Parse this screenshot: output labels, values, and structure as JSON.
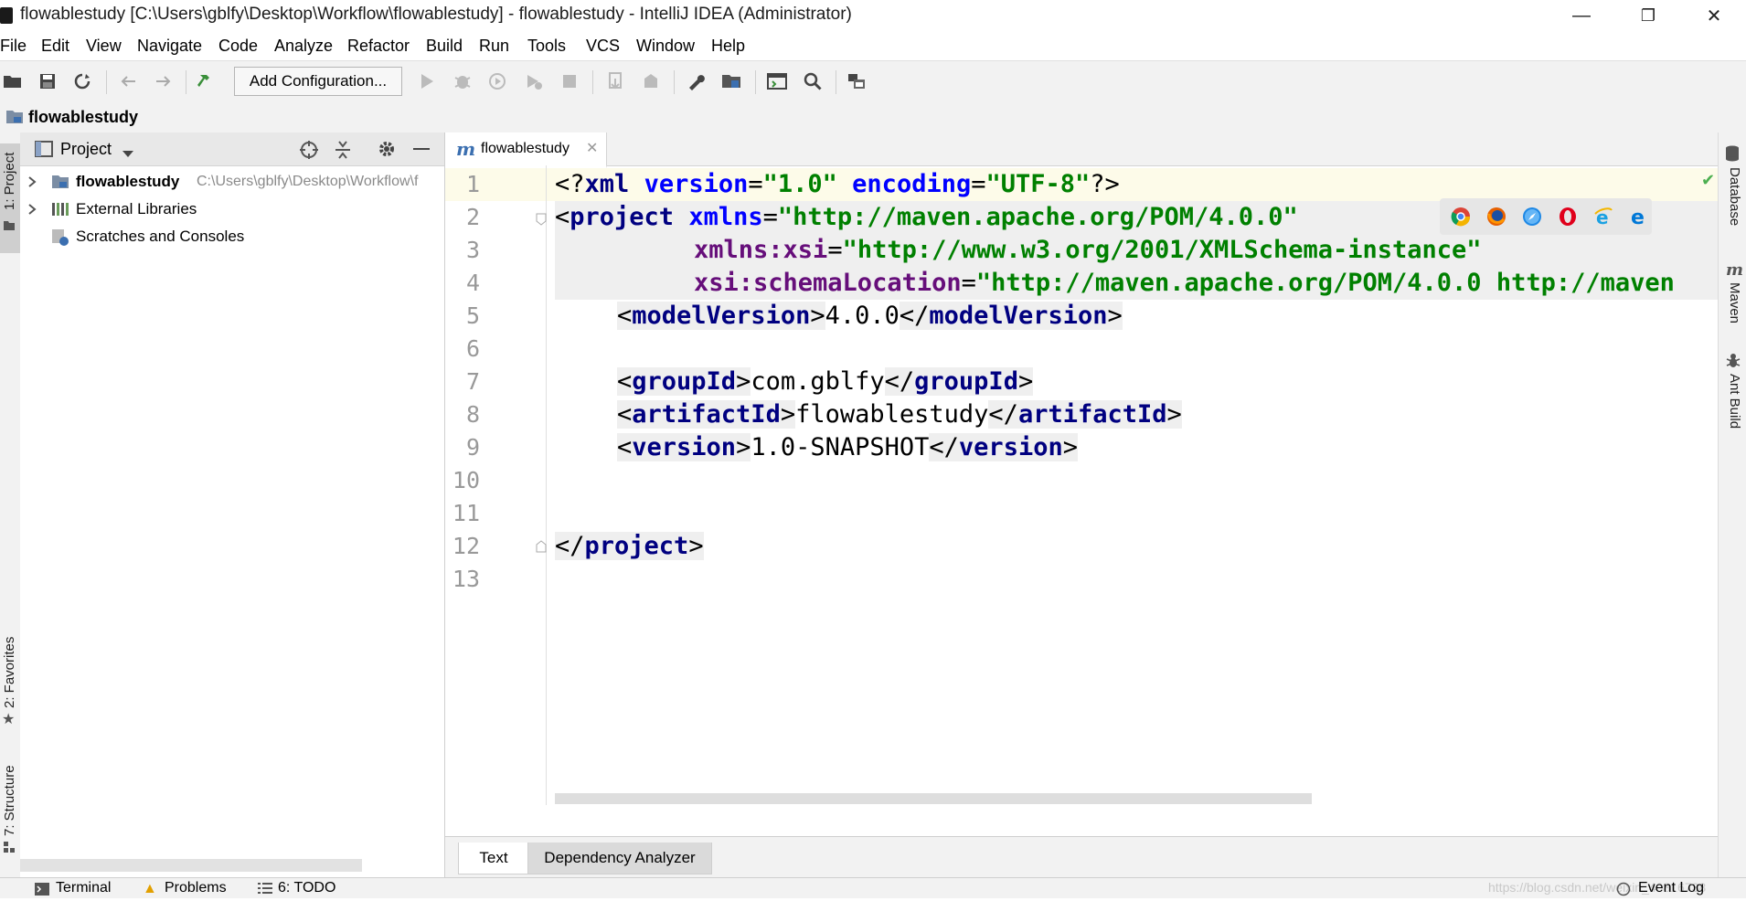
{
  "window": {
    "title": "flowablestudy [C:\\Users\\gblfy\\Desktop\\Workflow\\flowablestudy] - flowablestudy - IntelliJ IDEA (Administrator)",
    "minimize": "—",
    "restore": "❐",
    "close": "✕"
  },
  "menu": [
    "File",
    "Edit",
    "View",
    "Navigate",
    "Code",
    "Analyze",
    "Refactor",
    "Build",
    "Run",
    "Tools",
    "VCS",
    "Window",
    "Help"
  ],
  "toolbar": {
    "add_configuration": "Add Configuration..."
  },
  "breadcrumb": {
    "project": "flowablestudy"
  },
  "left_stripe": {
    "project_tab": "1: Project",
    "favorites_tab": "2: Favorites",
    "structure_tab": "7: Structure"
  },
  "project_panel": {
    "title": "Project",
    "tree": [
      {
        "label": "flowablestudy",
        "path": "C:\\Users\\gblfy\\Desktop\\Workflow\\f",
        "icon": "folder-icon"
      },
      {
        "label": "External Libraries",
        "icon": "libraries-icon"
      },
      {
        "label": "Scratches and Consoles",
        "icon": "scratches-icon"
      }
    ]
  },
  "editor": {
    "tab_label": "flowablestudy",
    "line_numbers": [
      "1",
      "2",
      "3",
      "4",
      "5",
      "6",
      "7",
      "8",
      "9",
      "10",
      "11",
      "12",
      "13"
    ],
    "code": {
      "l1_decl": "<?",
      "l1_xml": "xml",
      "l1_version_attr": "version",
      "l1_version_val": "\"1.0\"",
      "l1_encoding_attr": "encoding",
      "l1_encoding_val": "\"UTF-8\"",
      "l1_end": "?>",
      "l2_tag": "project",
      "l2_attr": "xmlns",
      "l2_val": "\"http://maven.apache.org/POM/4.0.0\"",
      "l3_ns": "xmlns:xsi",
      "l3_val": "\"http://www.w3.org/2001/XMLSchema-instance\"",
      "l4_ns": "xsi:schemaLocation",
      "l4_val": "\"http://maven.apache.org/POM/4.0.0 http://maven",
      "l5_tag": "modelVersion",
      "l5_val": "4.0.0",
      "l7_tag": "groupId",
      "l7_val": "com.gblfy",
      "l8_tag": "artifactId",
      "l8_val": "flowablestudy",
      "l9_tag": "version",
      "l9_val": "1.0-SNAPSHOT",
      "l12_tag": "project"
    },
    "bottom_tabs": [
      "Text",
      "Dependency Analyzer"
    ]
  },
  "right_stripe": {
    "database": "Database",
    "maven": "Maven",
    "ant": "Ant Build"
  },
  "status_bar": {
    "terminal": "Terminal",
    "problems": "Problems",
    "todo": "6: TODO",
    "event_log": "Event Log",
    "watermark": "https://blog.csdn.net/weixin_40816738"
  }
}
